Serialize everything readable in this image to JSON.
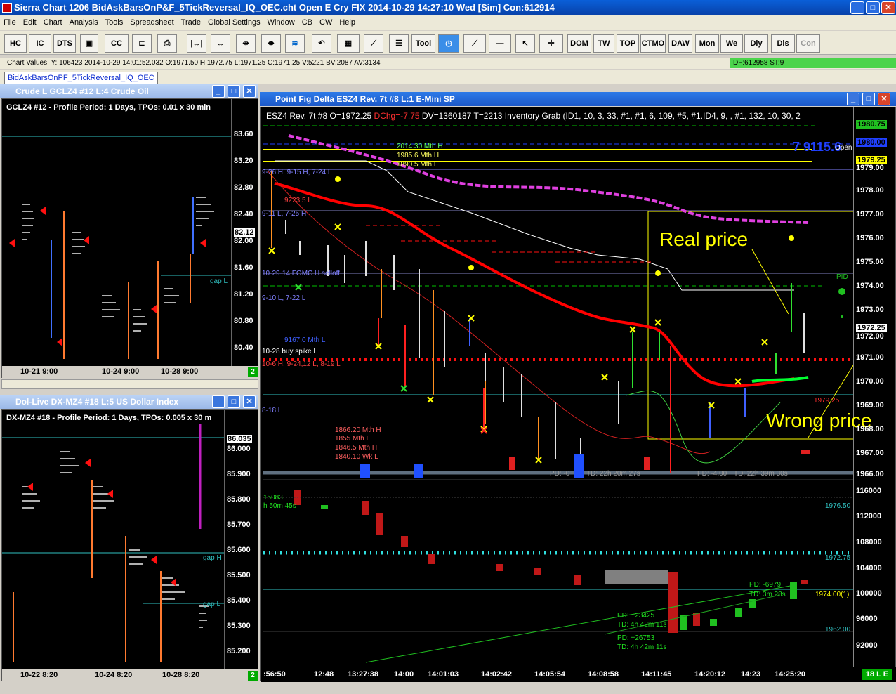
{
  "window": {
    "title": "Sierra Chart 1206 BidAskBarsOnP&F_5TickReversal_IQ_OEC.cht  Open E Cry FIX 2014-10-29  14:27:10 Wed [Sim]  Con:612914"
  },
  "menu": [
    "File",
    "Edit",
    "Chart",
    "Analysis",
    "Tools",
    "Spreadsheet",
    "Trade",
    "Global Settings",
    "Window",
    "CB",
    "CW",
    "Help"
  ],
  "toolbar": {
    "hc": "HC",
    "ic": "IC",
    "dts": "DTS",
    "cc": "CC",
    "tool": "Tool",
    "dom": "DOM",
    "tw": "TW",
    "top": "TOP",
    "ctmo": "CTMO",
    "daw": "DAW",
    "mon": "Mon",
    "we": "We",
    "dly": "Dly",
    "dis": "Dis",
    "con": "Con"
  },
  "valuebar": {
    "text": "Chart Values: Y: 106423  2014-10-29  14:01:52.032  O:1971.50  H:1972.75  L:1971.25  C:1971.25  V:5221  BV:2087  AV:3134",
    "df": "DF:612958  ST:9"
  },
  "tab": {
    "label": "BidAskBarsOnPF_5TickReversal_IQ_OEC"
  },
  "crude": {
    "title": "Crude L  GCLZ4  #12  L:4  Crude Oil",
    "header": "GCLZ4  #12 - Profile Period: 1 Days, TPOs: 0.01 x 30 min",
    "prices": [
      "83.60",
      "83.20",
      "82.80",
      "82.40",
      "82.12",
      "82.00",
      "81.60",
      "81.20",
      "80.80",
      "80.40"
    ],
    "gap": "gap L",
    "dates": [
      "10-21  9:00",
      "10-24  9:00",
      "10-28  9:00"
    ],
    "badge": "2"
  },
  "dollar": {
    "title": "Dol-Live  DX-MZ4  #18  L:5  US Dollar Index",
    "header": "DX-MZ4  #18 - Profile Period: 1 Days, TPOs: 0.005 x 30 m",
    "prices": [
      "86.035",
      "86.000",
      "85.900",
      "85.800",
      "85.700",
      "85.600",
      "85.500",
      "85.400",
      "85.300",
      "85.200"
    ],
    "gapH": "gap H",
    "gapL": "gap L",
    "dates": [
      "10-22  8:20",
      "10-24  8:20",
      "10-28  8:20"
    ],
    "badge": "2"
  },
  "main": {
    "title": "Point Fig Delta  ESZ4  Rev. 7t  #8  L:1  E-Mini SP",
    "header": "ESZ4  Rev. 7t  #8 O=1972.25 ",
    "dchg": "DChg=-7.75",
    "header2": " DV=1360187 T=2213 Inventory Grab   (ID1, 10, 3, 33, #1, #1, 6, 109, #5, #1.ID4, 9, , #1, 132, 10, 30, 2",
    "prices": [
      "1980.75",
      "1980.00",
      "1979.25",
      "1979.00",
      "1978.00",
      "1977.00",
      "1976.00",
      "1975.00",
      "1974.00",
      "1973.00",
      "1972.25",
      "1972.00",
      "1971.00",
      "1970.00",
      "1969.00",
      "1968.00",
      "1967.00",
      "1966.00"
    ],
    "lower_prices": [
      "116000",
      "112000",
      "108000",
      "104000",
      "100000",
      "96000",
      "92000"
    ],
    "big": "7 9115.6",
    "open": "Open",
    "annotations": {
      "real": "Real price",
      "wrong": "Wrong price"
    },
    "levels": [
      "2014.30 Mth H",
      "1985.6 Mth H",
      "1890.5 Mth L",
      "9-26 H, 9-15 H, 7-24 L",
      "9223.5 L",
      "9-11 L, 7-25 H",
      "10-29-14 FOMC H selloff",
      "9-10 L, 7-22 L",
      "9167.0 Mth L",
      "10-28 buy spike L",
      "10-6 H, 9-24,12 L, 8-19 L",
      "8-18 L",
      "1866.20 Mth H",
      "1855 Mth L",
      "1846.5 Mth H",
      "1840.10 Wk L"
    ],
    "pd1": "PD: -0",
    "td1": "TD: 22h 20m 27s",
    "pd2": "PD: -4.00",
    "td2": "TD: 22h 39m 30s",
    "lower": {
      "v1": "15083",
      "t1": "h 50m 45s",
      "l1976": "1976.50",
      "l1972": "1972.75",
      "l1974": "1974.00(1)",
      "l1962": "1962.00",
      "pd3": "PD: -6979",
      "td3": "TD: 3m 28s",
      "pd4": "PD: +23425",
      "td4": "TD: 4h 42m 11s",
      "pd5": "PD: +26753",
      "td5": "TD: 4h 42m 11s",
      "lbl1979": "1979.25",
      "pid": "PID"
    },
    "times": [
      ":56:50",
      "12:48",
      "13:27:38",
      "14:00",
      "14:01:03",
      "14:02:42",
      "14:05:54",
      "14:08:58",
      "14:11:45",
      "14:20:12",
      "14:23",
      "14:25:20"
    ],
    "badge": "18 L E"
  },
  "colors": {
    "bg": "#000000",
    "price_red": "#ff0000",
    "yellow": "#ffff00",
    "magenta": "#e040e0",
    "green": "#00ff40",
    "cyan": "#40c0c0"
  }
}
